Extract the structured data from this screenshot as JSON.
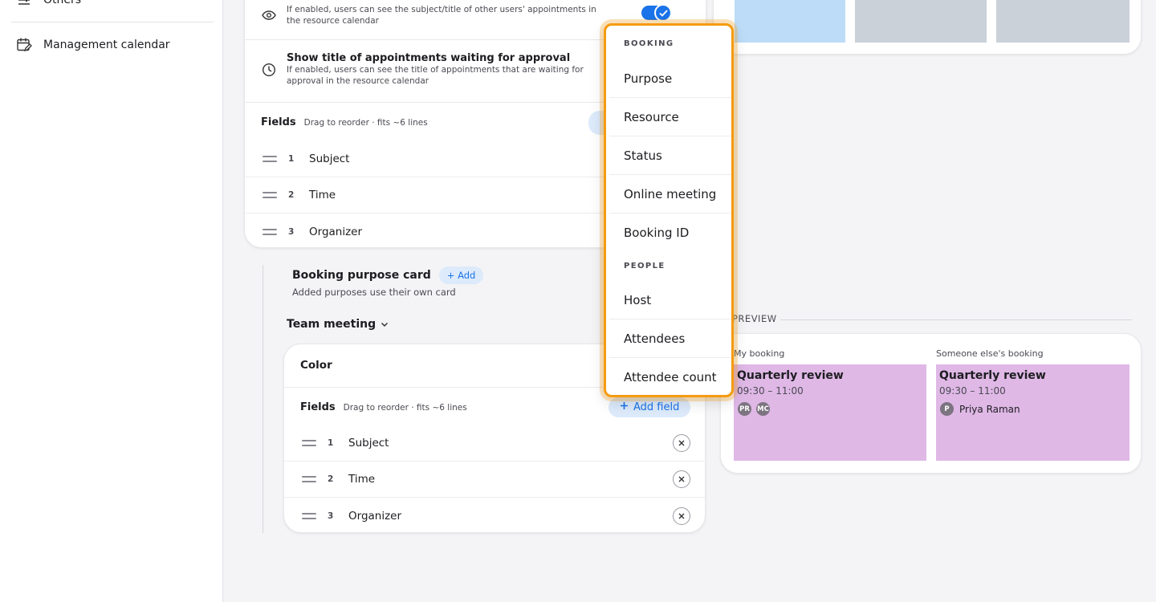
{
  "sidebar": {
    "items": [
      {
        "label": "Others",
        "icon": "sliders-icon"
      },
      {
        "label": "Management calendar",
        "icon": "calendar-edit-icon"
      }
    ]
  },
  "settings": {
    "show_subject": {
      "desc": "If enabled, users can see the subject/title of other users' appointments in the resource calendar",
      "enabled": true
    },
    "show_pending": {
      "title": "Show title of appointments waiting for approval",
      "desc": "If enabled, users can see the title of appointments that are waiting for approval in the resource calendar"
    }
  },
  "top_fields": {
    "label": "Fields",
    "hint": "Drag to reorder · fits ~6 lines",
    "rows": [
      {
        "num": "1",
        "name": "Subject"
      },
      {
        "num": "2",
        "name": "Time"
      },
      {
        "num": "3",
        "name": "Organizer"
      }
    ]
  },
  "booking_purpose": {
    "title": "Booking purpose card",
    "add_label": "+ Add",
    "subtitle": "Added purposes use their own card",
    "selected_purpose": "Team meeting"
  },
  "team_card": {
    "color_label": "Color",
    "color_value": "#d9a7ef",
    "fields_label": "Fields",
    "fields_hint": "Drag to reorder · fits ~6 lines",
    "add_field_label": "Add field",
    "rows": [
      {
        "num": "1",
        "name": "Subject"
      },
      {
        "num": "2",
        "name": "Time"
      },
      {
        "num": "3",
        "name": "Organizer"
      }
    ]
  },
  "preview": {
    "label": "PREVIEW",
    "my_booking": {
      "label": "My booking",
      "title": "Quarterly review",
      "time": "09:30 – 11:00",
      "avatars": [
        "PR",
        "MC"
      ]
    },
    "other_booking": {
      "label": "Someone else's booking",
      "title": "Quarterly review",
      "time": "09:30 – 11:00",
      "avatar": "P",
      "name": "Priya Raman"
    }
  },
  "menu": {
    "section_booking": "BOOKING",
    "booking_items": [
      "Purpose",
      "Resource",
      "Status",
      "Online meeting",
      "Booking ID"
    ],
    "section_people": "PEOPLE",
    "people_items": [
      "Host",
      "Attendees",
      "Attendee count"
    ]
  },
  "colors": {
    "accent": "#1a73e8",
    "highlight": "#f59b11",
    "event_purple": "#dfb8e6"
  }
}
